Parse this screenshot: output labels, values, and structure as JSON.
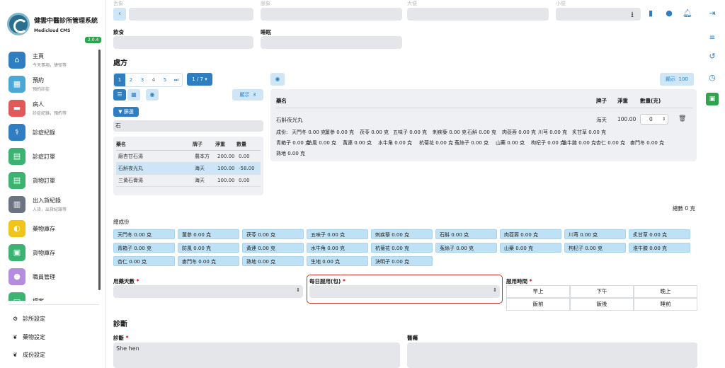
{
  "app": {
    "title": "健雲中醫診所管理系統",
    "subtitle": "Medicloud CMS",
    "version": "2.0.4"
  },
  "nav": [
    {
      "label": "主頁",
      "sub": "今天事項，捷徑等",
      "icon": "home-icon",
      "color": "#2f7ec1"
    },
    {
      "label": "預約",
      "sub": "預約診症",
      "icon": "calendar-icon",
      "color": "#4aa8d8"
    },
    {
      "label": "病人",
      "sub": "診症紀錄，預約等",
      "icon": "bed-icon",
      "color": "#e05a5a"
    },
    {
      "label": "診症紀錄",
      "sub": "",
      "icon": "stethoscope-icon",
      "color": "#2f7ec1"
    },
    {
      "label": "診症訂單",
      "sub": "",
      "icon": "receipt-icon",
      "color": "#3cb371"
    },
    {
      "label": "貨物訂單",
      "sub": "",
      "icon": "invoice-icon",
      "color": "#3cb371"
    },
    {
      "label": "出入貨紀錄",
      "sub": "入貨，出貨紀錄等",
      "icon": "warehouse-icon",
      "color": "#6b7480"
    },
    {
      "label": "藥物庫存",
      "sub": "",
      "icon": "pills-icon",
      "color": "#f0c419"
    },
    {
      "label": "貨物庫存",
      "sub": "",
      "icon": "boxes-icon",
      "color": "#3cb371"
    },
    {
      "label": "職員管理",
      "sub": "",
      "icon": "staff-icon",
      "color": "#b58de0"
    },
    {
      "label": "標案",
      "sub": "",
      "icon": "folder-icon",
      "color": "#3cb371"
    }
  ],
  "settings": [
    {
      "label": "診所設定",
      "icon": "gears-icon"
    },
    {
      "label": "藥物設定",
      "icon": "leaf-icon"
    },
    {
      "label": "成份設定",
      "icon": "leaf-icon"
    }
  ],
  "top_fields": {
    "faded_labels": [
      "舌象",
      "脈象",
      "大便",
      "小便"
    ],
    "diet_label": "飲食",
    "sleep_label": "睡眠"
  },
  "prescription": {
    "title": "處方",
    "pages": [
      "1",
      "2",
      "3",
      "4",
      "5",
      "⏭"
    ],
    "page_select": "1 / 7 ▾",
    "show_label": "顯示",
    "show_count": "3",
    "filter_label": "篩選",
    "search_value": "石",
    "list_headers": [
      "藥名",
      "牌子",
      "淨重",
      "數量"
    ],
    "list_rows": [
      {
        "name": "廠杏甘石湯",
        "brand": "農本方",
        "weight": "200.00",
        "qty": "0.00",
        "selected": false
      },
      {
        "name": "石斛夜光丸",
        "brand": "海天",
        "weight": "100.00",
        "qty": "-58.00",
        "selected": true
      },
      {
        "name": "三黃石膏湯",
        "brand": "海天",
        "weight": "100.00",
        "qty": "0.00",
        "selected": false
      }
    ],
    "right_show_label": "顯示",
    "right_show_count": "100",
    "selected_headers": [
      "藥名",
      "牌子",
      "淨重",
      "數量(克)"
    ],
    "selected_item": {
      "name": "石斛夜光丸",
      "brand": "海天",
      "weight": "100.00",
      "qty": "0"
    },
    "components_prefix": "成份:",
    "components": [
      "天門冬 0.00 克",
      "薑參 0.00 克",
      "茯苓 0.00 克",
      "五味子 0.00 克",
      "刺疾藜 0.00 克",
      "石斛 0.00 克",
      "肉蓯蓉 0.00 克",
      "川芎 0.00 克",
      "炙甘草 0.00 克",
      "青箱子 0.00 克",
      "防風 0.00 克",
      "黃連 0.00 克",
      "水牛角 0.00 克",
      "杭菊花 0.00 克",
      "菟絲子 0.00 克",
      "山藥 0.00 克",
      "枸杞子 0.00 克",
      "淮牛膝 0.00 克",
      "杏仁 0.00 克",
      "麥門冬 0.00 克",
      "熟地 0.00 克",
      "生地 0.00 克",
      "決明子 0.00 克"
    ],
    "total_label": "總數 0 克"
  },
  "total_components": {
    "title": "總成份",
    "chips": [
      "天門冬 0.00 克",
      "薑參 0.00 克",
      "茯苓 0.00 克",
      "五味子 0.00 克",
      "刺疾藜 0.00 克",
      "石斛 0.00 克",
      "肉蓯蓉 0.00 克",
      "川芎 0.00 克",
      "炙甘草 0.00 克",
      "青箱子 0.00 克",
      "防風 0.00 克",
      "黃連 0.00 克",
      "水牛角 0.00 克",
      "杭菊花 0.00 克",
      "菟絲子 0.00 克",
      "山藥 0.00 克",
      "枸杞子 0.00 克",
      "淮牛膝 0.00 克",
      "杏仁 0.00 克",
      "麥門冬 0.00 克",
      "熟地 0.00 克",
      "生地 0.00 克",
      "決明子 0.00 克"
    ]
  },
  "dosage": {
    "days_label": "用藥天數",
    "daily_label": "每日服用(包)",
    "time_label": "服用時間",
    "time_cells": [
      "早上",
      "下午",
      "晚上",
      "飯前",
      "飯後",
      "睡前"
    ],
    "required_mark": "*"
  },
  "diagnosis": {
    "title": "診斷",
    "diag_label": "診斷",
    "diag_value": "She hen",
    "advice_label": "醫囑"
  },
  "toolbar": [
    "download-icon",
    "clipboard-icon",
    "user-icon",
    "bell-icon",
    "logout-icon"
  ],
  "side_tools": [
    "list-icon",
    "history-icon",
    "clock-icon",
    "save-icon"
  ]
}
